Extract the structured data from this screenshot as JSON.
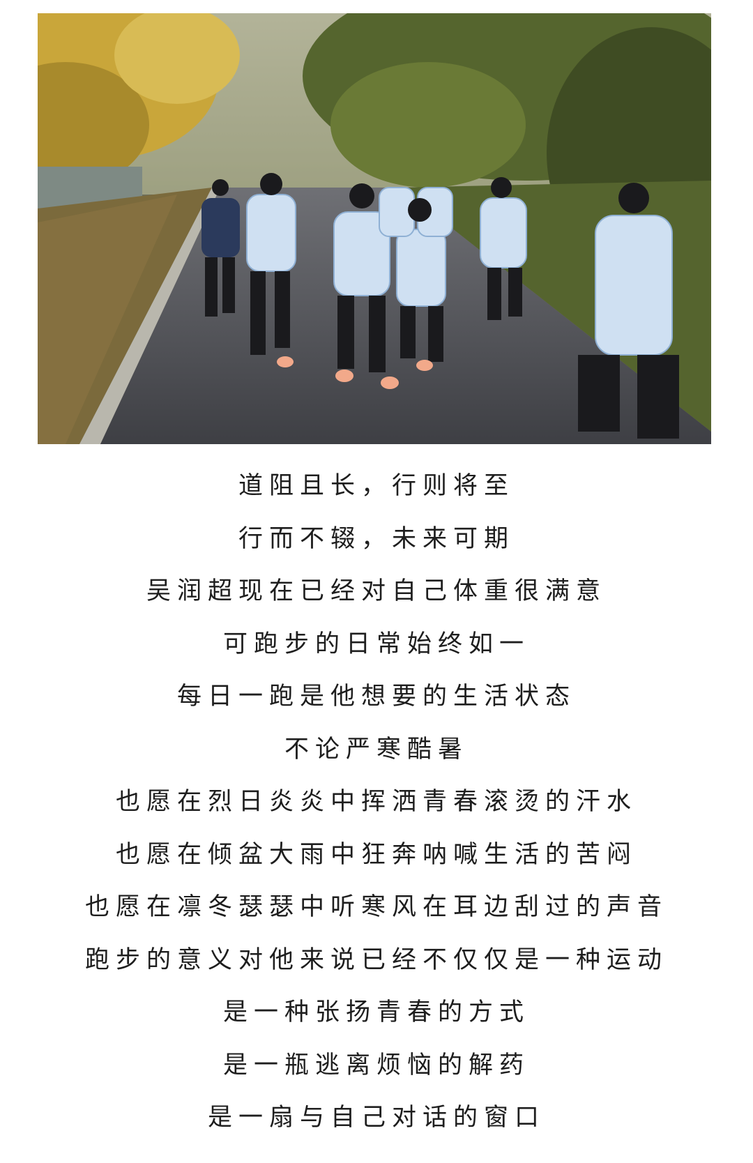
{
  "photo": {
    "description_icon": "photo-running-group"
  },
  "caption_lines": [
    "道阻且长，行则将至",
    "行而不辍，未来可期",
    "吴润超现在已经对自己体重很满意",
    "可跑步的日常始终如一",
    "每日一跑是他想要的生活状态",
    "不论严寒酷暑",
    "也愿在烈日炎炎中挥洒青春滚烫的汗水",
    "也愿在倾盆大雨中狂奔呐喊生活的苦闷",
    "也愿在凛冬瑟瑟中听寒风在耳边刮过的声音",
    "跑步的意义对他来说已经不仅仅是一种运动",
    "是一种张扬青春的方式",
    "是一瓶逃离烦恼的解药",
    "是一扇与自己对话的窗口"
  ]
}
